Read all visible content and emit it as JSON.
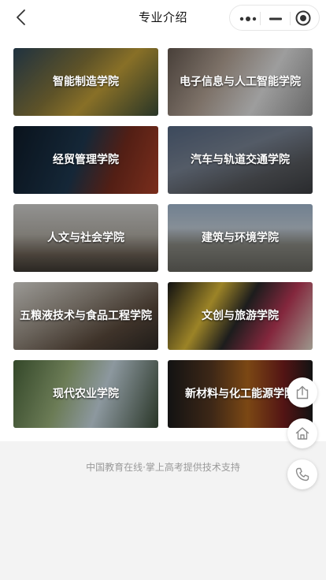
{
  "header": {
    "title": "专业介绍",
    "back_icon": "chevron-left-icon",
    "more_icon": "more-dots-icon",
    "minimize_icon": "minimize-icon",
    "record_icon": "target-icon"
  },
  "colleges": [
    {
      "name": "智能制造学院"
    },
    {
      "name": "电子信息与人工智能学院"
    },
    {
      "name": "经贸管理学院"
    },
    {
      "name": "汽车与轨道交通学院"
    },
    {
      "name": "人文与社会学院"
    },
    {
      "name": "建筑与环境学院"
    },
    {
      "name": "五粮液技术与食品工程学院"
    },
    {
      "name": "文创与旅游学院"
    },
    {
      "name": "现代农业学院"
    },
    {
      "name": "新材料与化工能源学院"
    }
  ],
  "footer": {
    "text": "中国教育在线·掌上高考提供技术支持"
  },
  "float_buttons": {
    "share_icon": "share-icon",
    "home_icon": "home-icon",
    "phone_icon": "phone-icon"
  }
}
